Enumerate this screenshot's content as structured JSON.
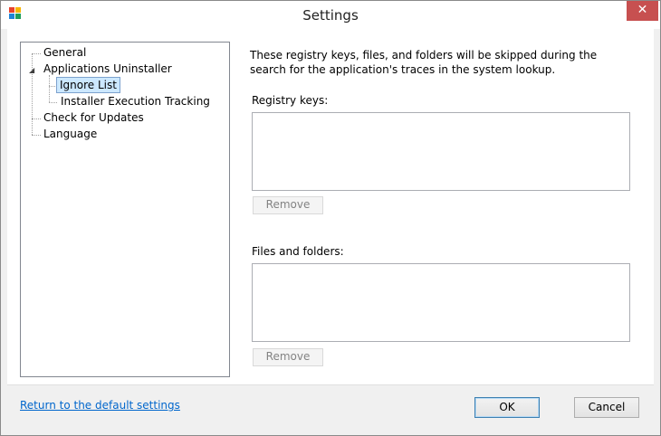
{
  "window": {
    "title": "Settings",
    "close_glyph": "✕"
  },
  "tree": {
    "items": [
      {
        "label": "General"
      },
      {
        "label": "Applications Uninstaller",
        "expander": "◢"
      },
      {
        "label": "Ignore List",
        "selected": true
      },
      {
        "label": "Installer Execution Tracking"
      },
      {
        "label": "Check for Updates"
      },
      {
        "label": "Language"
      }
    ]
  },
  "panel": {
    "description": "These registry keys, files, and folders will be skipped during the search for the application's traces in the system lookup.",
    "registry_label": "Registry keys:",
    "registry_remove": "Remove",
    "files_label": "Files and folders:",
    "files_remove": "Remove"
  },
  "footer": {
    "default_link": "Return to the default settings",
    "ok": "OK",
    "cancel": "Cancel"
  },
  "colors": {
    "accent": "#0066cc",
    "close": "#c75050",
    "selection": "#cce8ff",
    "logo": [
      "#e8412c",
      "#f7b500",
      "#1f84d6",
      "#1f9e5a"
    ]
  }
}
